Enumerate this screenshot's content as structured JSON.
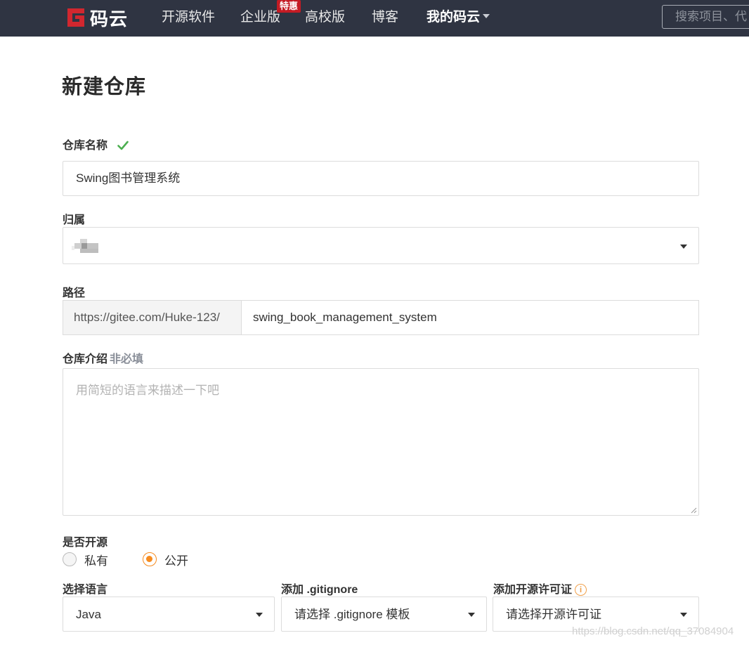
{
  "nav": {
    "logo_text": "码云",
    "items": [
      {
        "label": "开源软件"
      },
      {
        "label": "企业版"
      },
      {
        "label": "高校版"
      },
      {
        "label": "博客"
      },
      {
        "label": "我的码云"
      }
    ],
    "badge": "特惠",
    "search_placeholder": "搜索项目、代"
  },
  "page": {
    "title": "新建仓库"
  },
  "form": {
    "repo_name_label": "仓库名称",
    "repo_name_value": "Swing图书管理系统",
    "owner_label": "归属",
    "path_label": "路径",
    "path_prefix": "https://gitee.com/Huke-123/",
    "path_value": "swing_book_management_system",
    "desc_label": "仓库介绍",
    "desc_optional": "非必填",
    "desc_placeholder": "用简短的语言来描述一下吧",
    "open_source_label": "是否开源",
    "visibility": {
      "private": "私有",
      "public": "公开",
      "selected": "public"
    },
    "language_label": "选择语言",
    "language_value": "Java",
    "gitignore_label": "添加 .gitignore",
    "gitignore_placeholder": "请选择 .gitignore 模板",
    "license_label": "添加开源许可证",
    "license_placeholder": "请选择开源许可证"
  },
  "watermark": "https://blog.csdn.net/qq_37084904",
  "colors": {
    "navbar_bg": "#2f3442",
    "accent_orange": "#f68b1f",
    "check_green": "#4caf50",
    "badge_red": "#c41b24"
  }
}
